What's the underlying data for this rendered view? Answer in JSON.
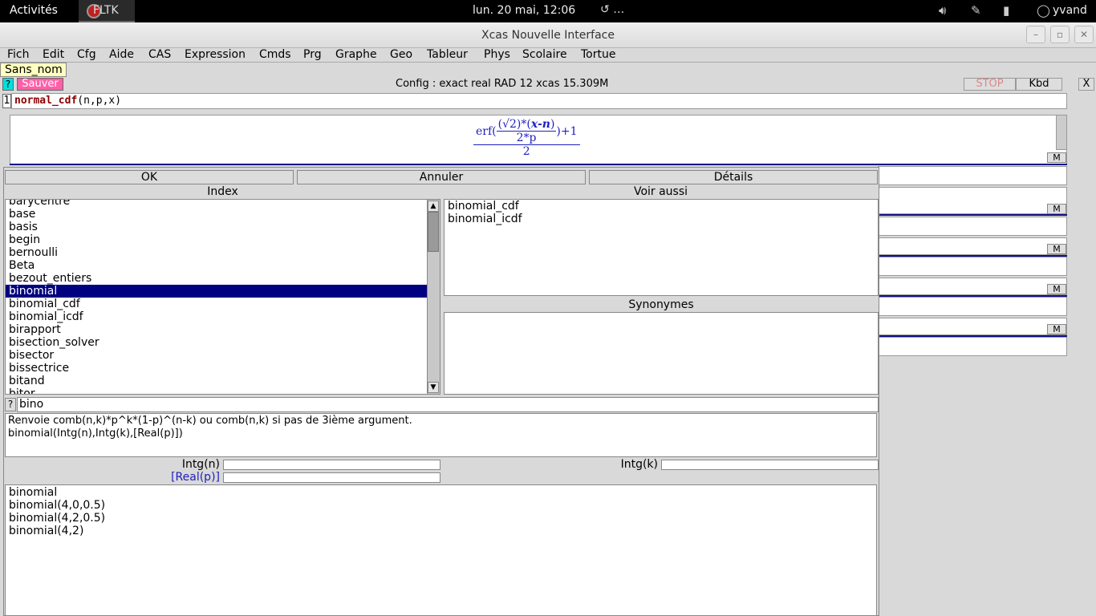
{
  "topbar": {
    "activities": "Activités",
    "app_name": "FLTK",
    "clock": "lun. 20 mai, 12:06",
    "history_label": "…",
    "user": "yvand"
  },
  "window": {
    "title": "Xcas Nouvelle Interface"
  },
  "menubar": {
    "items": [
      "Fich",
      "Edit",
      "Cfg",
      "Aide",
      "CAS",
      "Expression",
      "Cmds",
      "Prg",
      "Graphe",
      "Geo",
      "Tableur",
      "Phys",
      "Scolaire",
      "Tortue"
    ]
  },
  "session": {
    "tab_name": "Sans_nom",
    "help_button": "?",
    "save_button": "Sauver",
    "config": "Config  : exact real RAD 12 xcas 15.309M",
    "stop_button": "STOP",
    "kbd_button": "Kbd",
    "close_button": "X"
  },
  "entry": {
    "line_number": "1",
    "command_name": "normal_cdf",
    "command_args": "(n,p,x)"
  },
  "output": {
    "erf_open": "erf(",
    "num_part": "(√2)*(",
    "num_var": "x-n",
    "num_close": ")",
    "denom": "2*p",
    "plus_one": ")+1",
    "bottom": "2",
    "m_label": "M"
  },
  "dialog": {
    "ok": "OK",
    "cancel": "Annuler",
    "details": "Détails",
    "index_header": "Index",
    "see_also_header": "Voir aussi",
    "synonyms_header": "Synonymes",
    "index_items": [
      "barycentre",
      "base",
      "basis",
      "begin",
      "bernoulli",
      "Beta",
      "bezout_entiers",
      "binomial",
      "binomial_cdf",
      "binomial_icdf",
      "birapport",
      "bisection_solver",
      "bisector",
      "bissectrice",
      "bitand",
      "bitor"
    ],
    "selected_index": "binomial",
    "see_also": [
      "binomial_cdf",
      "binomial_icdf"
    ],
    "search_help": "?",
    "search_value": "bino",
    "description_line1": "Renvoie comb(n,k)*p^k*(1-p)^(n-k) ou comb(n,k) si pas de 3ième argument.",
    "description_line2": "binomial(Intg(n),Intg(k),[Real(p)])",
    "param1_label": "Intg(n)",
    "param2_label": "Intg(k)",
    "param3_label": "[Real(p)]",
    "examples": [
      "binomial",
      "binomial(4,0,0.5)",
      "binomial(4,2,0.5)",
      "binomial(4,2)"
    ]
  },
  "colors": {
    "selection": "#000080",
    "save_button": "#ff5fa8",
    "help_button": "#00e0e0",
    "formula": "#2020c0",
    "tab_bg": "#ffffc0"
  }
}
